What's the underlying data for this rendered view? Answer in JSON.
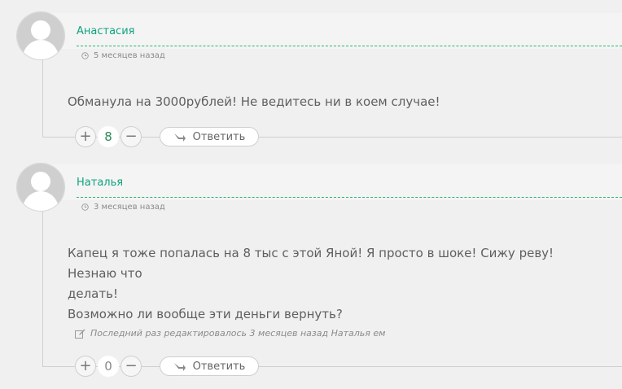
{
  "comments": [
    {
      "author": "Анастасия",
      "time": "5 месяцев назад",
      "text_lines": [
        "Обманула на 3000рублей! Не ведитесь ни в коем случае!"
      ],
      "edited_note": "",
      "votes": "8",
      "reply_label": "Ответить"
    },
    {
      "author": "Наталья",
      "time": "3 месяцев назад",
      "text_lines": [
        "Капец я тоже попалась на 8 тыс с этой Яной! Я просто в шоке! Сижу реву! Незнаю что",
        "делать!",
        "Возможно ли вообще эти деньги вернуть?"
      ],
      "edited_note": "Последний раз редактировалось 3 месяцев назад Наталья ем",
      "votes": "0",
      "reply_label": "Ответить"
    }
  ],
  "colors": {
    "author": "#10a37f",
    "vote_positive": "#2e8b57",
    "vote_zero": "#888888"
  },
  "icons": {
    "avatar": "default-user-icon",
    "time": "clock-icon",
    "edited": "edit-icon",
    "upvote": "plus-icon",
    "downvote": "minus-icon",
    "reply": "reply-arrow-icon"
  }
}
